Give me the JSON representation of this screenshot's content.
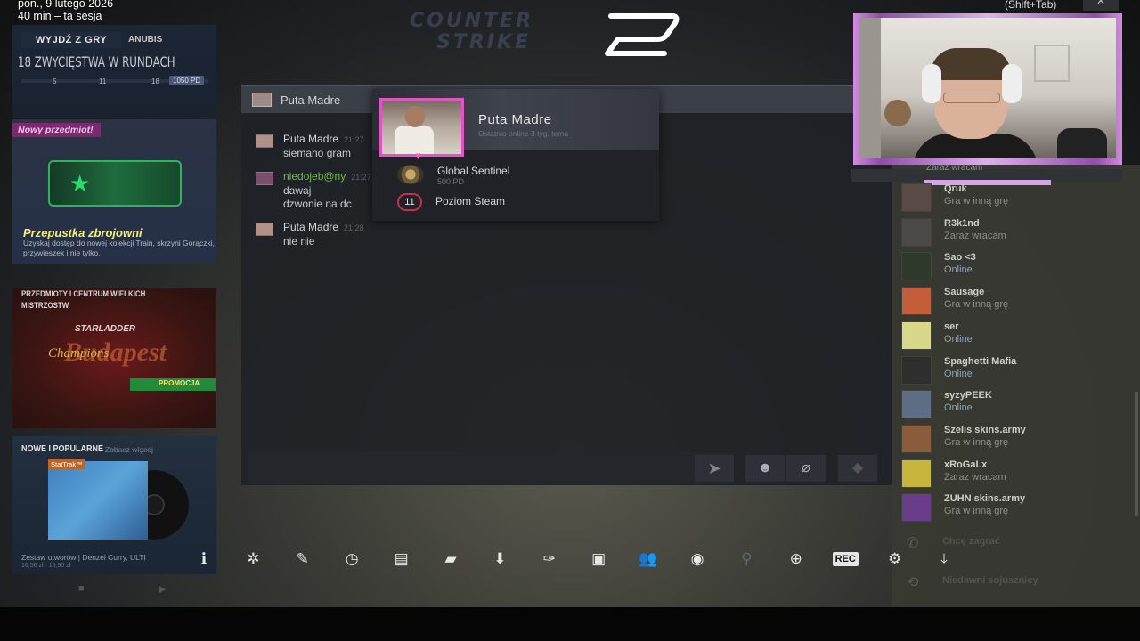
{
  "overlay": {
    "date": "pon., 9 lutego 2026",
    "session": "40 min – ta sesja",
    "shortcut": "(Shift+Tab)",
    "close": "✕"
  },
  "left_panel": {
    "quit_button": "WYJDŹ Z GRY",
    "map": "ANUBIS",
    "wins_title": "18 ZWYCIĘSTWA W RUNDACH",
    "wins_ticks": [
      "5",
      "11",
      "18"
    ],
    "wins_pd": "1050 PD",
    "new_item": "Nowy przedmiot!",
    "pass_title": "Przepustka zbrojowni",
    "pass_desc": "Uzyskaj dostęp do nowej kolekcji Train, skrzyni Gorączki, przywieszek i nie tylko.",
    "major_head": "PRZEDMIOTY I CENTRUM WIELKICH MISTRZOSTW",
    "major_logo": "STARLADDER",
    "major_champ": "Champions",
    "major_city": "Budapest",
    "major_promo": "PROMOCJA",
    "music_head": "NOWE I POPULARNE",
    "music_more": "Zobacz więcej",
    "music_badge": "StatTrak™",
    "music_title": "Zestaw utworów | Denzel Curry, ULTI",
    "music_sub": "16,56 zł · 15,90 zł"
  },
  "chat": {
    "header_name": "Puta Madre",
    "messages": [
      {
        "author": "Puta Madre",
        "time": "21:27",
        "lines": [
          "siemano gram"
        ],
        "author_color": "#d6d9dc"
      },
      {
        "author": "niedojeb@ny",
        "time": "21:27",
        "lines": [
          "dawaj",
          "dzwonie na dc"
        ],
        "author_color": "#6dbb48"
      },
      {
        "author": "Puta Madre",
        "time": "21:28",
        "lines": [
          "nie nie"
        ],
        "author_color": "#d6d9dc"
      }
    ],
    "send_icon": "➤",
    "emoji_icon": "☻",
    "attach_icon": "⌀"
  },
  "popup": {
    "name": "Puta Madre",
    "last_online": "Ostatnio online 3 tyg. temu",
    "rank": "Global Sentinel",
    "rank_pd": "500 PD",
    "level": "11",
    "level_label": "Poziom Steam"
  },
  "friends": {
    "partial_status": "Zaraz wracam",
    "list": [
      {
        "name": "Qruk",
        "status": "Gra w inną grę",
        "online": false,
        "avatar_color": "#5a4a45"
      },
      {
        "name": "R3k1nd",
        "status": "Zaraz wracam",
        "online": false,
        "avatar_color": "#4b4a46"
      },
      {
        "name": "Sao <3",
        "status": "Online",
        "online": true,
        "avatar_color": "#2f3a2c"
      },
      {
        "name": "Sausage",
        "status": "Gra w inną grę",
        "online": false,
        "avatar_color": "#c45e3a"
      },
      {
        "name": "ser",
        "status": "Online",
        "online": true,
        "avatar_color": "#d9d78a"
      },
      {
        "name": "Spaghetti Mafia",
        "status": "Online",
        "online": true,
        "avatar_color": "#2e2e2e"
      },
      {
        "name": "syzyPEEK",
        "status": "Online",
        "online": true,
        "avatar_color": "#5d6e86"
      },
      {
        "name": "Szelis skins.army",
        "status": "Gra w inną grę",
        "online": false,
        "avatar_color": "#8a5c3c"
      },
      {
        "name": "xRoGaLx",
        "status": "Zaraz wracam",
        "online": false,
        "avatar_color": "#c8b63c"
      },
      {
        "name": "ZUHN skins.army",
        "status": "Gra w inną grę",
        "online": false,
        "avatar_color": "#6a3d8a"
      }
    ],
    "sections": [
      {
        "label": "Chcę zagrać",
        "icon": "✆"
      },
      {
        "label": "Niedawni sojusznicy",
        "icon": "⟲"
      }
    ]
  },
  "toolbar": {
    "buttons": [
      {
        "name": "info-icon",
        "glyph": "ℹ"
      },
      {
        "name": "achievements-gear-icon",
        "glyph": "✲"
      },
      {
        "name": "pencil-icon",
        "glyph": "✎"
      },
      {
        "name": "clock-icon",
        "glyph": "◷"
      },
      {
        "name": "guide-icon",
        "glyph": "▤"
      },
      {
        "name": "chat-icon",
        "glyph": "▰"
      },
      {
        "name": "download-icon",
        "glyph": "⬇"
      },
      {
        "name": "wrench-icon",
        "glyph": "✑"
      },
      {
        "name": "screenshot-icon",
        "glyph": "▣"
      },
      {
        "name": "friends-icon",
        "glyph": "👥"
      },
      {
        "name": "eye-icon",
        "glyph": "◉"
      },
      {
        "name": "controller-icon",
        "glyph": "⚲"
      },
      {
        "name": "web-icon",
        "glyph": "⊕"
      },
      {
        "name": "rec-icon",
        "glyph": "REC"
      },
      {
        "name": "settings-icon",
        "glyph": "⚙"
      },
      {
        "name": "collapse-icon",
        "glyph": "⤓"
      }
    ]
  }
}
